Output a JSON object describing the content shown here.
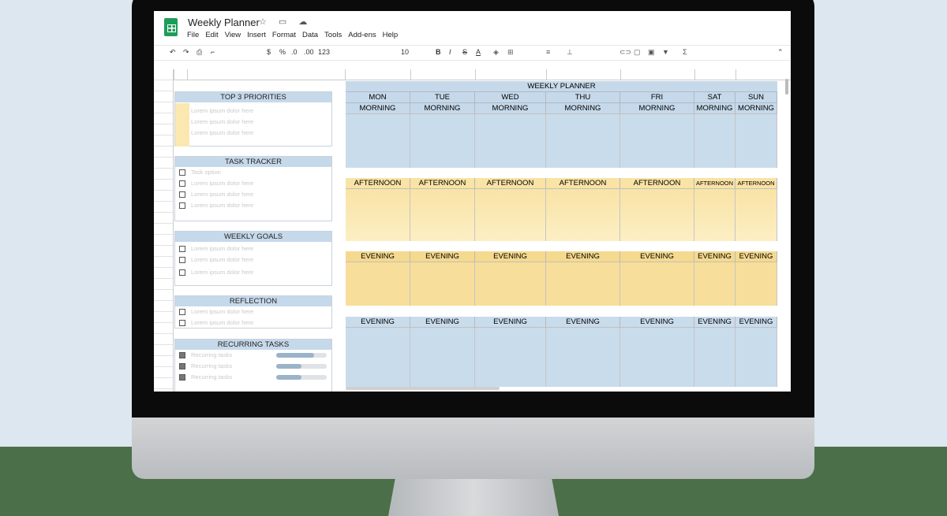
{
  "app": {
    "doc_title": "Weekly Planner",
    "title_icons": "☆ ▭ ☁",
    "menus": [
      "File",
      "Edit",
      "View",
      "Insert",
      "Format",
      "Data",
      "Tools",
      "Add-ens",
      "Help"
    ]
  },
  "toolbar": {
    "undo": "↶",
    "redo": "↷",
    "print": "⎙",
    "paint": "⌐",
    "currency": "$",
    "percent": "%",
    "dec_minus": ".0",
    "dec_plus": ".00",
    "format": "123",
    "font_size": "10",
    "bold": "B",
    "italic": "I",
    "strike": "S",
    "text_color": "A",
    "collapse": "⌃"
  },
  "panels": {
    "priorities": {
      "title": "TOP 3 PRIORITIES",
      "items": [
        "Lorem ipsum dolor here",
        "Lorem ipsum dolor here",
        "Lorem ipsum dolor here"
      ]
    },
    "tasks": {
      "title": "TASK TRACKER",
      "items": [
        "Task option",
        "Lorem ipsum dolor here",
        "Lorem ipsum dolor here",
        "Lorem ipsum dolor here"
      ]
    },
    "goals": {
      "title": "WEEKLY GOALS",
      "items": [
        "Lorem ipsum dolor here",
        "Lorem ipsum dolor here",
        "Lorem ipsum dolor here"
      ]
    },
    "reflection": {
      "title": "REFLECTION",
      "items": [
        "Lorem ipsum dolor here",
        "Lorem ipsum dolor here"
      ]
    },
    "recurring": {
      "title": "RECURRING TASKS",
      "items": [
        "Recurring tasks",
        "Recurring tasks",
        "Recurring tasks"
      ],
      "progress": [
        0.75,
        0.5,
        0.5
      ]
    }
  },
  "planner": {
    "title": "WEEKLY PLANNER",
    "days": [
      "MON",
      "TUE",
      "WED",
      "THU",
      "FRI",
      "SAT",
      "SUN"
    ],
    "morning": "MORNING",
    "afternoon": "AFTERNOON",
    "evening": "EVENING",
    "colors": {
      "morning": "#c9dcec",
      "afternoon": "#fcefc4",
      "evening": "#f7de9a",
      "header": "#c6d9ea",
      "afternoon_label": "#f9e3a5",
      "evening_label": "#f5d98e"
    }
  }
}
